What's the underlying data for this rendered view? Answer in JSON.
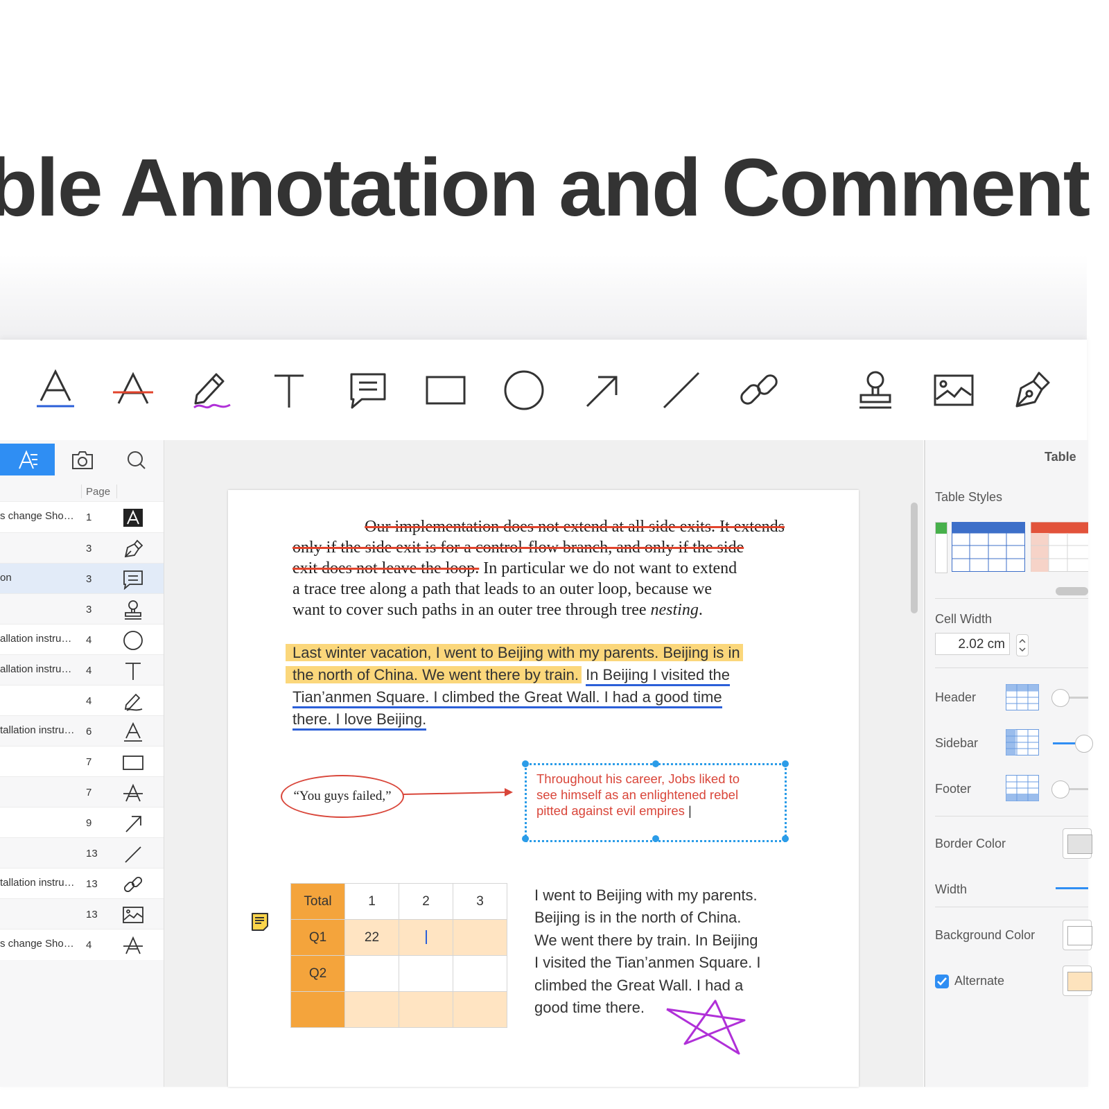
{
  "hero": {
    "title": "ble Annotation and Comment T"
  },
  "toolbar": {
    "tools": [
      "highlight-tool",
      "strikethrough-tool",
      "freehand-tool",
      "text-tool",
      "note-tool",
      "rectangle-tool",
      "ellipse-tool",
      "arrow-tool",
      "line-tool",
      "link-tool",
      "stamp-tool",
      "image-tool",
      "signature-tool"
    ],
    "colors": {
      "underline": "#2b5fd8",
      "strike": "#e2442c",
      "ink": "#b030d8"
    }
  },
  "sidebar": {
    "page_column": "Page",
    "rows": [
      {
        "label": "s change Sho…",
        "page": "1",
        "icon": "highlight-box-icon"
      },
      {
        "label": "",
        "page": "3",
        "icon": "signature-icon"
      },
      {
        "label": "on",
        "page": "3",
        "icon": "note-icon"
      },
      {
        "label": "",
        "page": "3",
        "icon": "stamp-icon"
      },
      {
        "label": "allation instru…",
        "page": "4",
        "icon": "ellipse-icon"
      },
      {
        "label": "allation instru…",
        "page": "4",
        "icon": "text-icon"
      },
      {
        "label": "",
        "page": "4",
        "icon": "freehand-icon"
      },
      {
        "label": "tallation instru…",
        "page": "6",
        "icon": "underline-icon"
      },
      {
        "label": "",
        "page": "7",
        "icon": "rectangle-icon"
      },
      {
        "label": "",
        "page": "7",
        "icon": "strikethrough-icon"
      },
      {
        "label": "",
        "page": "9",
        "icon": "arrow-icon"
      },
      {
        "label": "",
        "page": "13",
        "icon": "line-icon"
      },
      {
        "label": "tallation instru…",
        "page": "13",
        "icon": "link-icon"
      },
      {
        "label": "",
        "page": "13",
        "icon": "image-icon"
      },
      {
        "label": "s change Sho…",
        "page": "4",
        "icon": "strikethrough-icon"
      }
    ]
  },
  "document": {
    "strike_lines": [
      "Our implementation does not extend at all side exits. It extends",
      "only if the side exit is for a control-flow branch, and only if the side",
      "exit does not leave the loop."
    ],
    "strike_tail": " In particular we do not want to extend",
    "serif_lines": [
      "a trace tree along a path that leads to an outer loop, because we",
      "want to cover such paths in an outer tree through tree "
    ],
    "serif_italic": "nesting",
    "serif_end": ".",
    "hl_line1": "Last winter vacation, I went to Beijing with my parents. Beijing is in",
    "hl_line2": "the north of China. We went there by train.",
    "ul_line2": "In Beijing I visited the",
    "ul_line3": "Tian’anmen Square. I climbed the Great Wall. I had a good time",
    "ul_line4": "there. I love Beijing.",
    "bubble": "“You guys failed,”",
    "callout": [
      "Throughout his career, Jobs liked to",
      "see himself as an enlightened rebel",
      "pitted against evil empires"
    ],
    "table": {
      "header": [
        "Total",
        "1",
        "2",
        "3"
      ],
      "rows": [
        [
          "Q1",
          "22",
          "",
          ""
        ],
        [
          "Q2",
          "",
          "",
          ""
        ],
        [
          "",
          "",
          "",
          ""
        ]
      ]
    },
    "right_text": [
      "I went to Beijing with my parents.",
      "Beijing is in the north of China.",
      "We went there by train. In Beijing",
      "I visited the Tian’anmen Square. I",
      "climbed the Great Wall. I had a",
      "good time there."
    ]
  },
  "panel": {
    "title": "Table",
    "table_styles": "Table Styles",
    "cell_width_label": "Cell Width",
    "cell_width_value": "2.02 cm",
    "header_label": "Header",
    "sidebar_label": "Sidebar",
    "footer_label": "Footer",
    "border_color_label": "Border Color",
    "width_label": "Width",
    "background_color_label": "Background Color",
    "alternate_label": "Alternate",
    "accent": "#2f8ef3"
  }
}
